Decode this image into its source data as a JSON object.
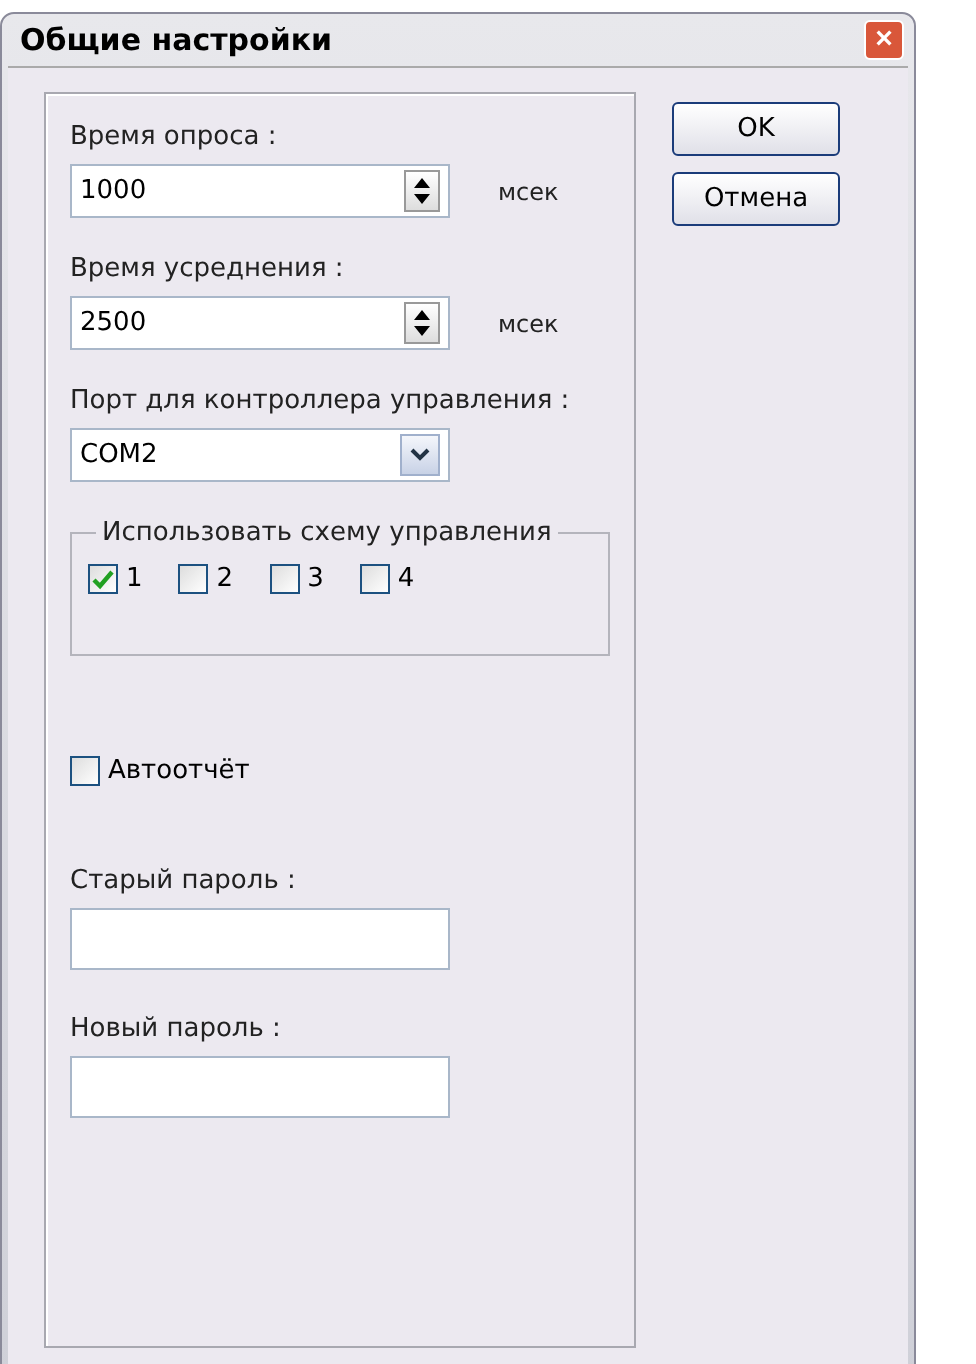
{
  "window": {
    "title": "Общие настройки",
    "close": "×"
  },
  "fields": [
    {
      "label": "Время опроса :",
      "value": "1000",
      "unit": "мсек"
    },
    {
      "label": "Время усреднения :",
      "value": "2500",
      "unit": "мсек"
    }
  ],
  "port": {
    "label": "Порт для контроллера управления :",
    "value": "COM2"
  },
  "scheme": {
    "legend": "Использовать схему управления",
    "options": [
      {
        "label": "1",
        "checked": true
      },
      {
        "label": "2",
        "checked": false
      },
      {
        "label": "3",
        "checked": false
      },
      {
        "label": "4",
        "checked": false
      }
    ]
  },
  "autoreport": {
    "label": "Автоотчёт",
    "checked": false
  },
  "old_password": {
    "label": "Старый пароль :"
  },
  "new_password": {
    "label": "Новый пароль :"
  },
  "buttons": [
    "OK",
    "Отмена"
  ]
}
